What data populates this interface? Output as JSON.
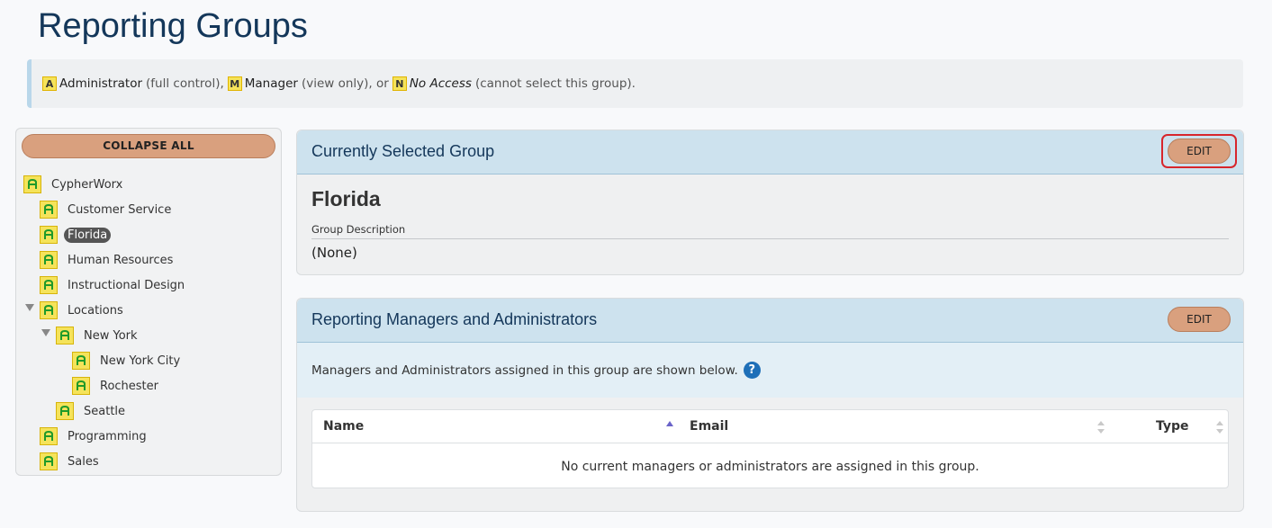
{
  "page": {
    "title": "Reporting Groups"
  },
  "legend": {
    "admin_badge": "A",
    "admin_label": "Administrator",
    "admin_desc": "(full control),",
    "manager_badge": "M",
    "manager_label": "Manager",
    "manager_desc": "(view only), or",
    "noaccess_badge": "N",
    "noaccess_label": "No Access",
    "noaccess_desc": "(cannot select this group)."
  },
  "sidebar": {
    "collapse_label": "COLLAPSE ALL",
    "items": [
      {
        "label": "CypherWorx"
      },
      {
        "label": "Customer Service"
      },
      {
        "label": "Florida"
      },
      {
        "label": "Human Resources"
      },
      {
        "label": "Instructional Design"
      },
      {
        "label": "Locations"
      },
      {
        "label": "New York"
      },
      {
        "label": "New York City"
      },
      {
        "label": "Rochester"
      },
      {
        "label": "Seattle"
      },
      {
        "label": "Programming"
      },
      {
        "label": "Sales"
      }
    ]
  },
  "selected_panel": {
    "heading": "Currently Selected Group",
    "edit_label": "EDIT",
    "group_name": "Florida",
    "desc_label": "Group Description",
    "desc_value": "(None)"
  },
  "managers_panel": {
    "heading": "Reporting Managers and Administrators",
    "edit_label": "EDIT",
    "info_text": "Managers and Administrators assigned in this group are shown below.",
    "help_glyph": "?",
    "columns": [
      "Name",
      "Email",
      "Type"
    ],
    "empty_message": "No current managers or administrators are assigned in this group."
  },
  "colors": {
    "accent_button": "#d9a07e",
    "badge_yellow": "#f5e35a",
    "heading_blue": "#14375a",
    "highlight_red": "#d7262c"
  }
}
